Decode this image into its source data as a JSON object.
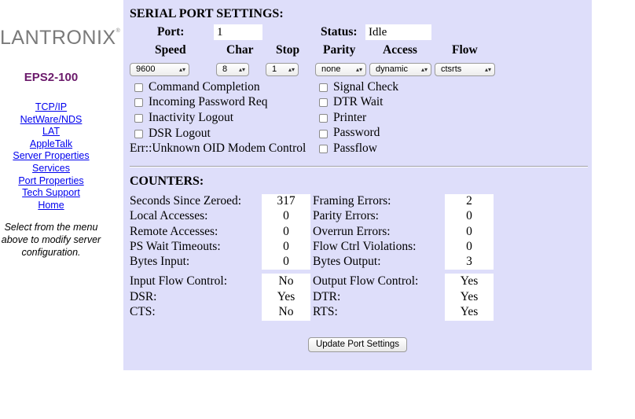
{
  "sidebar": {
    "logo": "LANTRONIX",
    "product": "EPS2-100",
    "menu": [
      "TCP/IP",
      "NetWare/NDS",
      "LAT",
      "AppleTalk",
      "Server Properties",
      "Services",
      "Port Properties",
      "Tech Support",
      "Home"
    ],
    "note_lines": [
      "Select from the menu",
      "above to modify server",
      "configuration."
    ]
  },
  "serial": {
    "heading": "SERIAL PORT SETTINGS:",
    "port_label": "Port:",
    "port_value": "1",
    "status_label": "Status:",
    "status_value": "Idle",
    "col_headers": [
      "Speed",
      "Char",
      "Stop",
      "Parity",
      "Access",
      "Flow"
    ],
    "selects": {
      "speed": "9600",
      "char": "8",
      "stop": "1",
      "parity": "none",
      "access": "dynamic",
      "flow": "ctsrts"
    },
    "left_options": [
      "Command Completion",
      "Incoming Password Req",
      "Inactivity Logout",
      "DSR Logout"
    ],
    "left_error": "Err::Unknown OID Modem Control",
    "right_options": [
      "Signal Check",
      "DTR Wait",
      "Printer",
      "Password",
      "Passflow"
    ]
  },
  "counters": {
    "heading": "COUNTERS:",
    "left": [
      {
        "label": "Seconds Since Zeroed:",
        "value": "317"
      },
      {
        "label": "Local Accesses:",
        "value": "0"
      },
      {
        "label": "Remote Accesses:",
        "value": "0"
      },
      {
        "label": "PS Wait Timeouts:",
        "value": "0"
      },
      {
        "label": "Bytes Input:",
        "value": "0"
      }
    ],
    "right": [
      {
        "label": "Framing Errors:",
        "value": "2"
      },
      {
        "label": "Parity Errors:",
        "value": "0"
      },
      {
        "label": "Overrun Errors:",
        "value": "0"
      },
      {
        "label": "Flow Ctrl Violations:",
        "value": "0"
      },
      {
        "label": "Bytes Output:",
        "value": "3"
      }
    ],
    "flow_left": [
      {
        "label": "Input Flow Control:",
        "value": "No"
      },
      {
        "label": "DSR:",
        "value": "Yes"
      },
      {
        "label": "CTS:",
        "value": "No"
      }
    ],
    "flow_right": [
      {
        "label": "Output Flow Control:",
        "value": "Yes"
      },
      {
        "label": "DTR:",
        "value": "Yes"
      },
      {
        "label": "RTS:",
        "value": "Yes"
      }
    ]
  },
  "update_button": "Update Port Settings"
}
